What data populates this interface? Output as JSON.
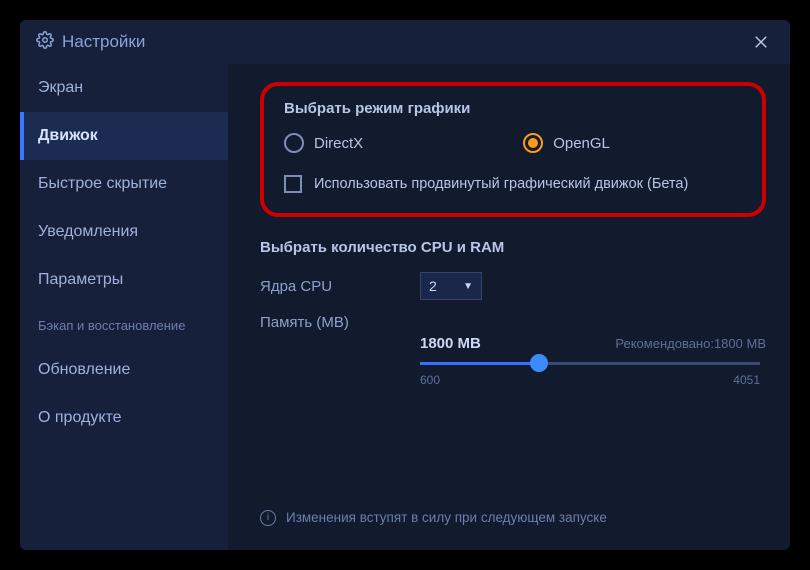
{
  "title": "Настройки",
  "sidebar": {
    "items": [
      {
        "label": "Экран"
      },
      {
        "label": "Движок"
      },
      {
        "label": "Быстрое скрытие"
      },
      {
        "label": "Уведомления"
      },
      {
        "label": "Параметры"
      },
      {
        "label": "Бэкап и восстановление"
      },
      {
        "label": "Обновление"
      },
      {
        "label": "О продукте"
      }
    ]
  },
  "graphics": {
    "title": "Выбрать режим графики",
    "directx": "DirectX",
    "opengl": "OpenGL",
    "advanced": "Использовать продвинутый графический движок (Бета)"
  },
  "cpuRam": {
    "title": "Выбрать количество CPU и RAM",
    "coresLabel": "Ядра CPU",
    "coresValue": "2",
    "memLabel": "Память (MB)",
    "memValue": "1800 MB",
    "recommended": "Рекомендовано:1800 MB",
    "min": "600",
    "max": "4051"
  },
  "note": "Изменения вступят в силу при следующем запуске"
}
